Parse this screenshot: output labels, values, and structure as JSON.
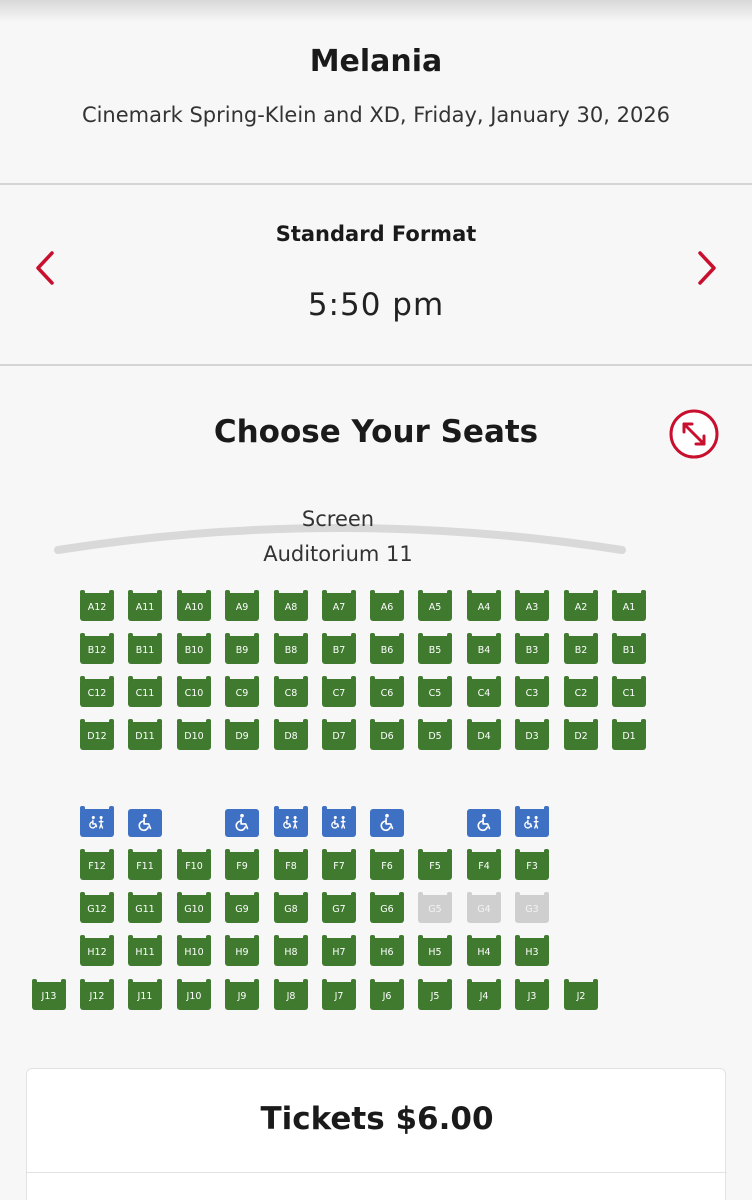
{
  "header": {
    "title": "Melania",
    "subtitle": "Cinemark Spring-Klein and XD, Friday, January 30, 2026"
  },
  "showtime": {
    "format": "Standard Format",
    "time": "5:50 pm",
    "prev_icon": "chevron-left-icon",
    "next_icon": "chevron-right-icon"
  },
  "seat_map": {
    "title": "Choose Your Seats",
    "expand_icon": "expand-icon",
    "screen_label": "Screen",
    "auditorium": "Auditorium 11",
    "colors": {
      "available": "#3f7a2f",
      "unavailable": "#cfcfcf",
      "accessible": "#3e70c4",
      "accent": "#c8102e"
    },
    "rows": [
      {
        "row": "A",
        "seats": [
          {
            "label": "A12",
            "status": "available"
          },
          {
            "label": "A11",
            "status": "available"
          },
          {
            "label": "A10",
            "status": "available"
          },
          {
            "label": "A9",
            "status": "available"
          },
          {
            "label": "A8",
            "status": "available"
          },
          {
            "label": "A7",
            "status": "available"
          },
          {
            "label": "A6",
            "status": "available"
          },
          {
            "label": "A5",
            "status": "available"
          },
          {
            "label": "A4",
            "status": "available"
          },
          {
            "label": "A3",
            "status": "available"
          },
          {
            "label": "A2",
            "status": "available"
          },
          {
            "label": "A1",
            "status": "available"
          }
        ]
      },
      {
        "row": "B",
        "seats": [
          {
            "label": "B12",
            "status": "available"
          },
          {
            "label": "B11",
            "status": "available"
          },
          {
            "label": "B10",
            "status": "available"
          },
          {
            "label": "B9",
            "status": "available"
          },
          {
            "label": "B8",
            "status": "available"
          },
          {
            "label": "B7",
            "status": "available"
          },
          {
            "label": "B6",
            "status": "available"
          },
          {
            "label": "B5",
            "status": "available"
          },
          {
            "label": "B4",
            "status": "available"
          },
          {
            "label": "B3",
            "status": "available"
          },
          {
            "label": "B2",
            "status": "available"
          },
          {
            "label": "B1",
            "status": "available"
          }
        ]
      },
      {
        "row": "C",
        "seats": [
          {
            "label": "C12",
            "status": "available"
          },
          {
            "label": "C11",
            "status": "available"
          },
          {
            "label": "C10",
            "status": "available"
          },
          {
            "label": "C9",
            "status": "available"
          },
          {
            "label": "C8",
            "status": "available"
          },
          {
            "label": "C7",
            "status": "available"
          },
          {
            "label": "C6",
            "status": "available"
          },
          {
            "label": "C5",
            "status": "available"
          },
          {
            "label": "C4",
            "status": "available"
          },
          {
            "label": "C3",
            "status": "available"
          },
          {
            "label": "C2",
            "status": "available"
          },
          {
            "label": "C1",
            "status": "available"
          }
        ]
      },
      {
        "row": "D",
        "seats": [
          {
            "label": "D12",
            "status": "available"
          },
          {
            "label": "D11",
            "status": "available"
          },
          {
            "label": "D10",
            "status": "available"
          },
          {
            "label": "D9",
            "status": "available"
          },
          {
            "label": "D8",
            "status": "available"
          },
          {
            "label": "D7",
            "status": "available"
          },
          {
            "label": "D6",
            "status": "available"
          },
          {
            "label": "D5",
            "status": "available"
          },
          {
            "label": "D4",
            "status": "available"
          },
          {
            "label": "D3",
            "status": "available"
          },
          {
            "label": "D2",
            "status": "available"
          },
          {
            "label": "D1",
            "status": "available"
          }
        ]
      },
      {
        "row": "E",
        "seats": [
          {
            "label": "",
            "status": "companion"
          },
          {
            "label": "",
            "status": "wheelchair"
          },
          {
            "label": "",
            "status": "gap"
          },
          {
            "label": "",
            "status": "wheelchair"
          },
          {
            "label": "",
            "status": "companion"
          },
          {
            "label": "",
            "status": "companion"
          },
          {
            "label": "",
            "status": "wheelchair"
          },
          {
            "label": "",
            "status": "gap"
          },
          {
            "label": "",
            "status": "wheelchair"
          },
          {
            "label": "",
            "status": "companion"
          }
        ]
      },
      {
        "row": "F",
        "seats": [
          {
            "label": "F12",
            "status": "available"
          },
          {
            "label": "F11",
            "status": "available"
          },
          {
            "label": "F10",
            "status": "available"
          },
          {
            "label": "F9",
            "status": "available"
          },
          {
            "label": "F8",
            "status": "available"
          },
          {
            "label": "F7",
            "status": "available"
          },
          {
            "label": "F6",
            "status": "available"
          },
          {
            "label": "F5",
            "status": "available"
          },
          {
            "label": "F4",
            "status": "available"
          },
          {
            "label": "F3",
            "status": "available"
          }
        ]
      },
      {
        "row": "G",
        "seats": [
          {
            "label": "G12",
            "status": "available"
          },
          {
            "label": "G11",
            "status": "available"
          },
          {
            "label": "G10",
            "status": "available"
          },
          {
            "label": "G9",
            "status": "available"
          },
          {
            "label": "G8",
            "status": "available"
          },
          {
            "label": "G7",
            "status": "available"
          },
          {
            "label": "G6",
            "status": "available"
          },
          {
            "label": "G5",
            "status": "unavailable"
          },
          {
            "label": "G4",
            "status": "unavailable"
          },
          {
            "label": "G3",
            "status": "unavailable"
          }
        ]
      },
      {
        "row": "H",
        "seats": [
          {
            "label": "H12",
            "status": "available"
          },
          {
            "label": "H11",
            "status": "available"
          },
          {
            "label": "H10",
            "status": "available"
          },
          {
            "label": "H9",
            "status": "available"
          },
          {
            "label": "H8",
            "status": "available"
          },
          {
            "label": "H7",
            "status": "available"
          },
          {
            "label": "H6",
            "status": "available"
          },
          {
            "label": "H5",
            "status": "available"
          },
          {
            "label": "H4",
            "status": "available"
          },
          {
            "label": "H3",
            "status": "available"
          }
        ]
      },
      {
        "row": "J",
        "seats": [
          {
            "label": "J13",
            "status": "available"
          },
          {
            "label": "J12",
            "status": "available"
          },
          {
            "label": "J11",
            "status": "available"
          },
          {
            "label": "J10",
            "status": "available"
          },
          {
            "label": "J9",
            "status": "available"
          },
          {
            "label": "J8",
            "status": "available"
          },
          {
            "label": "J7",
            "status": "available"
          },
          {
            "label": "J6",
            "status": "available"
          },
          {
            "label": "J5",
            "status": "available"
          },
          {
            "label": "J4",
            "status": "available"
          },
          {
            "label": "J3",
            "status": "available"
          },
          {
            "label": "J2",
            "status": "available"
          }
        ]
      }
    ]
  },
  "tickets": {
    "title": "Tickets $6.00"
  }
}
